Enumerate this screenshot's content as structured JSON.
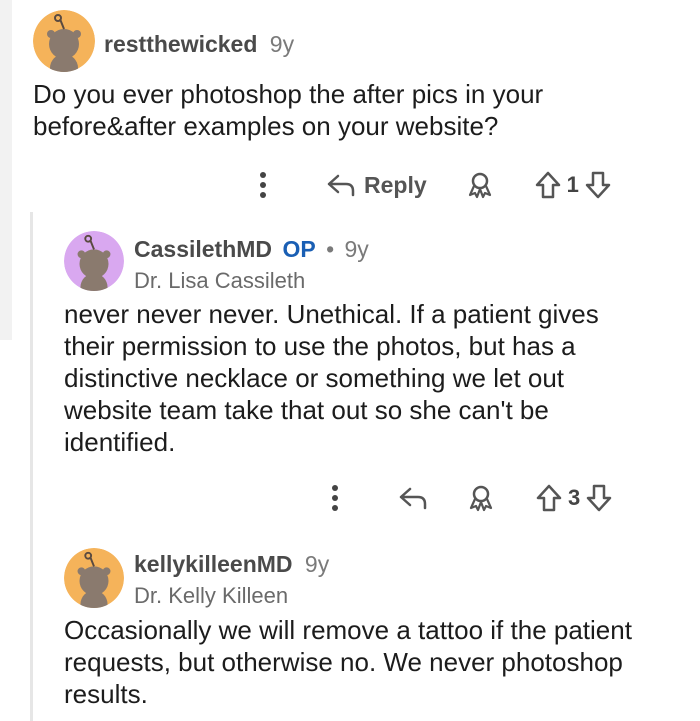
{
  "comments": [
    {
      "username": "restthewicked",
      "age": "9y",
      "body": "Do you ever photoshop the after pics in your before&after examples on your website?",
      "actions": {
        "reply_label": "Reply",
        "vote_count": "1"
      },
      "avatar_color": "#f5b35a"
    },
    {
      "username": "CassilethMD",
      "op_badge": "OP",
      "separator": "•",
      "age": "9y",
      "flair": "Dr. Lisa Cassileth",
      "body": "never never never. Unethical. If a patient gives their permission to use the photos, but has a distinctive necklace or something we let out website team take that out so she can't be identified.",
      "actions": {
        "vote_count": "3"
      },
      "avatar_color": "#d9a8f0"
    },
    {
      "username": "kellykilleenMD",
      "age": "9y",
      "flair": "Dr. Kelly Killeen",
      "body": "Occasionally we will remove a tattoo if the patient requests, but otherwise no. We never photoshop results.",
      "avatar_color": "#f5b35a"
    }
  ],
  "colors": {
    "op": "#1a5fb4",
    "icon": "#555555"
  }
}
